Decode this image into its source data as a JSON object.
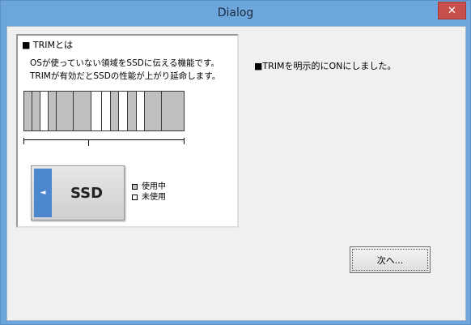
{
  "window": {
    "title": "Dialog",
    "close_label": "✕"
  },
  "info_panel": {
    "heading": "■ TRIMとは",
    "description": "OSが使っていない領域をSSDに伝える機能です。\nTRIMが有効だとSSDの性能が上がり延命します。",
    "block_states": [
      "used",
      "used",
      "free",
      "used",
      "used",
      "used",
      "free",
      "free",
      "used",
      "free",
      "used",
      "free",
      "used",
      "used"
    ],
    "ssd_label": "SSD",
    "ssd_arrow": "◄",
    "legend": [
      {
        "label": "使用中",
        "color": "#c0c0c0"
      },
      {
        "label": "未使用",
        "color": "#ffffff"
      }
    ]
  },
  "status_text": "■TRIMを明示的にONにしました。",
  "next_button": "次へ..."
}
